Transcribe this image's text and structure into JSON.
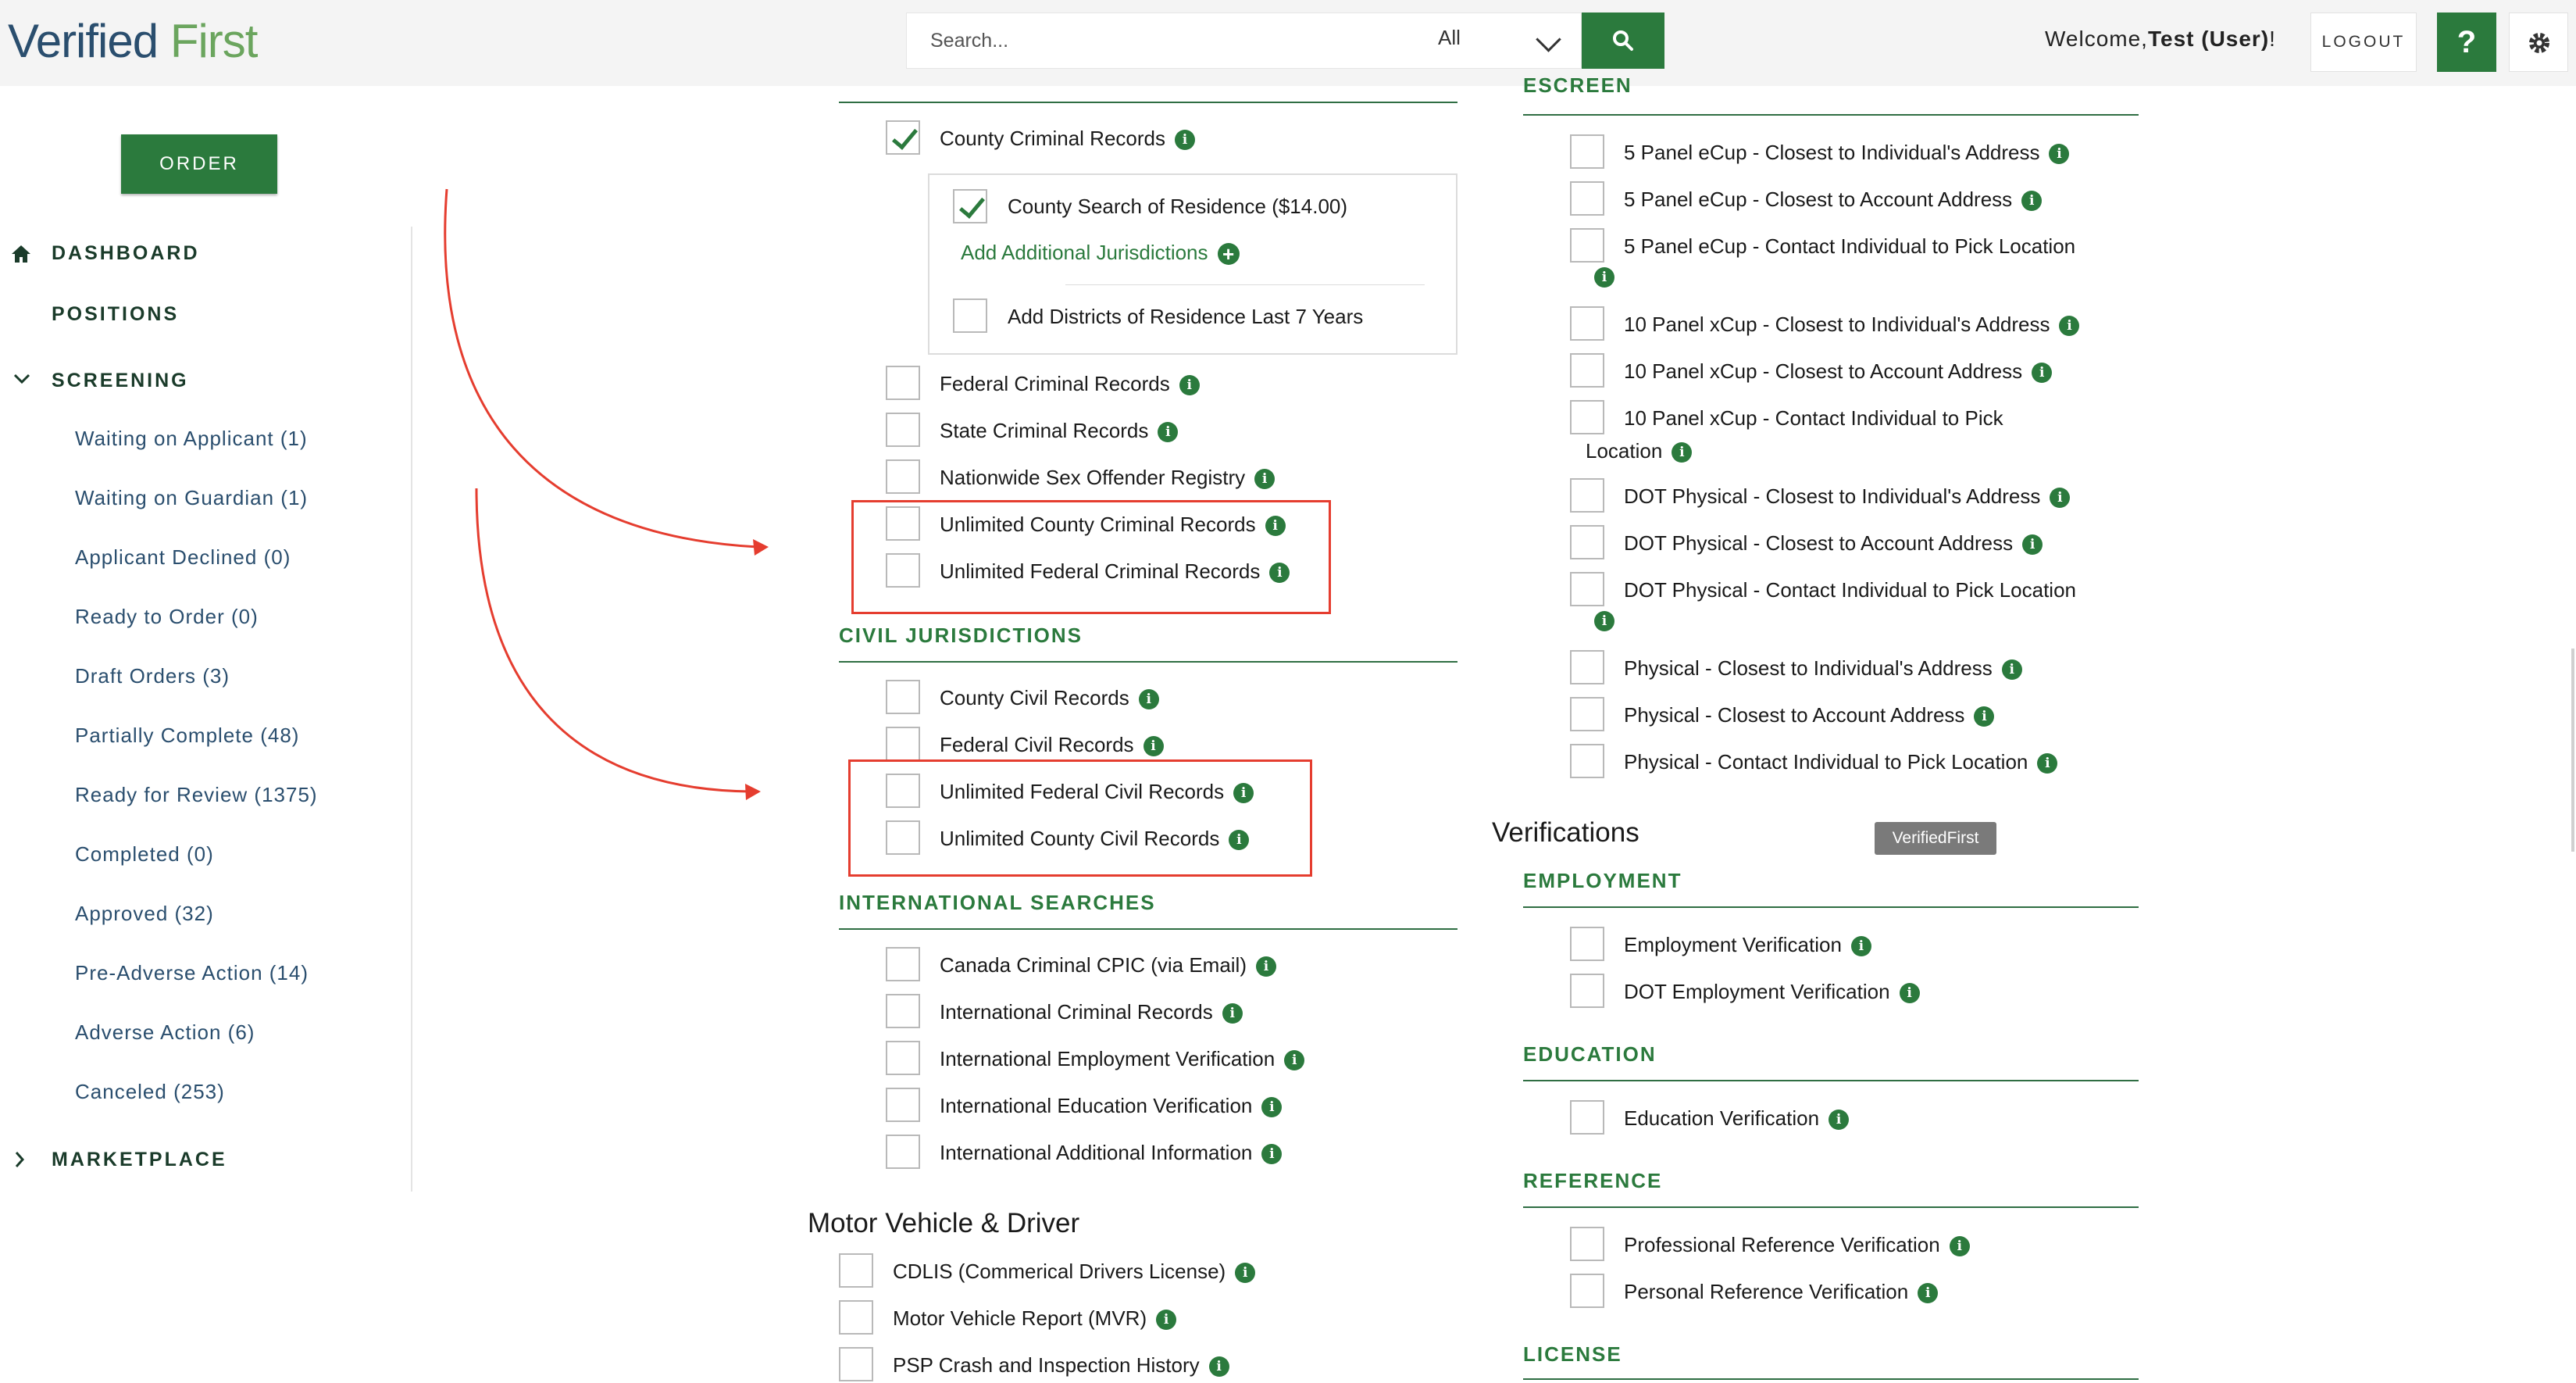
{
  "header": {
    "logo": {
      "part1": "Verified",
      "part2": "First"
    },
    "search": {
      "placeholder": "Search...",
      "scope": "All"
    },
    "welcome": {
      "prefix": "Welcome,",
      "user": "Test (User)",
      "suffix": "!"
    },
    "logout_label": "LOGOUT",
    "help_label": "?"
  },
  "sidebar": {
    "order_label": "ORDER",
    "dashboard": "DASHBOARD",
    "positions": "POSITIONS",
    "screening": "SCREENING",
    "screening_items": [
      "Waiting on Applicant (1)",
      "Waiting on Guardian (1)",
      "Applicant Declined (0)",
      "Ready to Order (0)",
      "Draft Orders (3)",
      "Partially Complete (48)",
      "Ready for Review (1375)",
      "Completed (0)",
      "Approved (32)",
      "Pre-Adverse Action (14)",
      "Adverse Action (6)",
      "Canceled (253)"
    ],
    "marketplace": "MARKETPLACE"
  },
  "criminal": {
    "items": [
      {
        "label": "County Criminal Records",
        "checked": true
      },
      {
        "label": "Federal Criminal Records",
        "checked": false
      },
      {
        "label": "State Criminal Records",
        "checked": false
      },
      {
        "label": "Nationwide Sex Offender Registry",
        "checked": false
      },
      {
        "label": "Unlimited County Criminal Records",
        "checked": false
      },
      {
        "label": "Unlimited Federal Criminal Records",
        "checked": false
      }
    ],
    "sub": {
      "county_residence": "County Search of Residence ($14.00)",
      "add_jurisdictions": "Add Additional Jurisdictions",
      "add_districts": "Add Districts of Residence Last 7 Years"
    }
  },
  "civil": {
    "heading": "CIVIL JURISDICTIONS",
    "items": [
      {
        "label": "County Civil Records"
      },
      {
        "label": "Federal Civil Records"
      },
      {
        "label": "Unlimited Federal Civil Records"
      },
      {
        "label": "Unlimited County Civil Records"
      }
    ]
  },
  "international": {
    "heading": "INTERNATIONAL SEARCHES",
    "items": [
      {
        "label": "Canada Criminal CPIC (via Email)"
      },
      {
        "label": "International Criminal Records"
      },
      {
        "label": "International Employment Verification"
      },
      {
        "label": "International Education Verification"
      },
      {
        "label": "International Additional Information"
      }
    ]
  },
  "motor": {
    "heading": "Motor Vehicle & Driver",
    "items": [
      {
        "label": "CDLIS (Commerical Drivers License)"
      },
      {
        "label": "Motor Vehicle Report (MVR)"
      },
      {
        "label": "PSP Crash and Inspection History"
      }
    ]
  },
  "escreen": {
    "heading": "ESCREEN",
    "items": [
      {
        "label": "5 Panel eCup - Closest to Individual's Address"
      },
      {
        "label": "5 Panel eCup - Closest to Account Address"
      },
      {
        "label": "5 Panel eCup - Contact Individual to Pick Location"
      },
      {
        "label": "10 Panel xCup - Closest to Individual's Address"
      },
      {
        "label": "10 Panel xCup - Closest to Account Address"
      },
      {
        "label": "10 Panel xCup - Contact Individual to Pick",
        "label2": "Location"
      },
      {
        "label": "DOT Physical - Closest to Individual's Address"
      },
      {
        "label": "DOT Physical - Closest to Account Address"
      },
      {
        "label": "DOT Physical - Contact Individual to Pick Location"
      },
      {
        "label": "Physical - Closest to Individual's Address"
      },
      {
        "label": "Physical - Closest to Account Address"
      },
      {
        "label": "Physical - Contact Individual to Pick Location"
      }
    ]
  },
  "verifications": {
    "heading": "Verifications",
    "tooltip": "VerifiedFirst",
    "employment": {
      "heading": "EMPLOYMENT",
      "items": [
        {
          "label": "Employment Verification"
        },
        {
          "label": "DOT Employment Verification"
        }
      ]
    },
    "education": {
      "heading": "EDUCATION",
      "items": [
        {
          "label": "Education Verification"
        }
      ]
    },
    "reference": {
      "heading": "REFERENCE",
      "items": [
        {
          "label": "Professional Reference Verification"
        },
        {
          "label": "Personal Reference Verification"
        }
      ]
    },
    "license": {
      "heading": "LICENSE"
    }
  },
  "icons": {
    "info": "i",
    "plus": "+"
  },
  "colors": {
    "brand_green": "#2b7a3d",
    "logo_blue": "#2a4e6e",
    "logo_green": "#6ba55e",
    "annotation_red": "#e53d2f"
  }
}
